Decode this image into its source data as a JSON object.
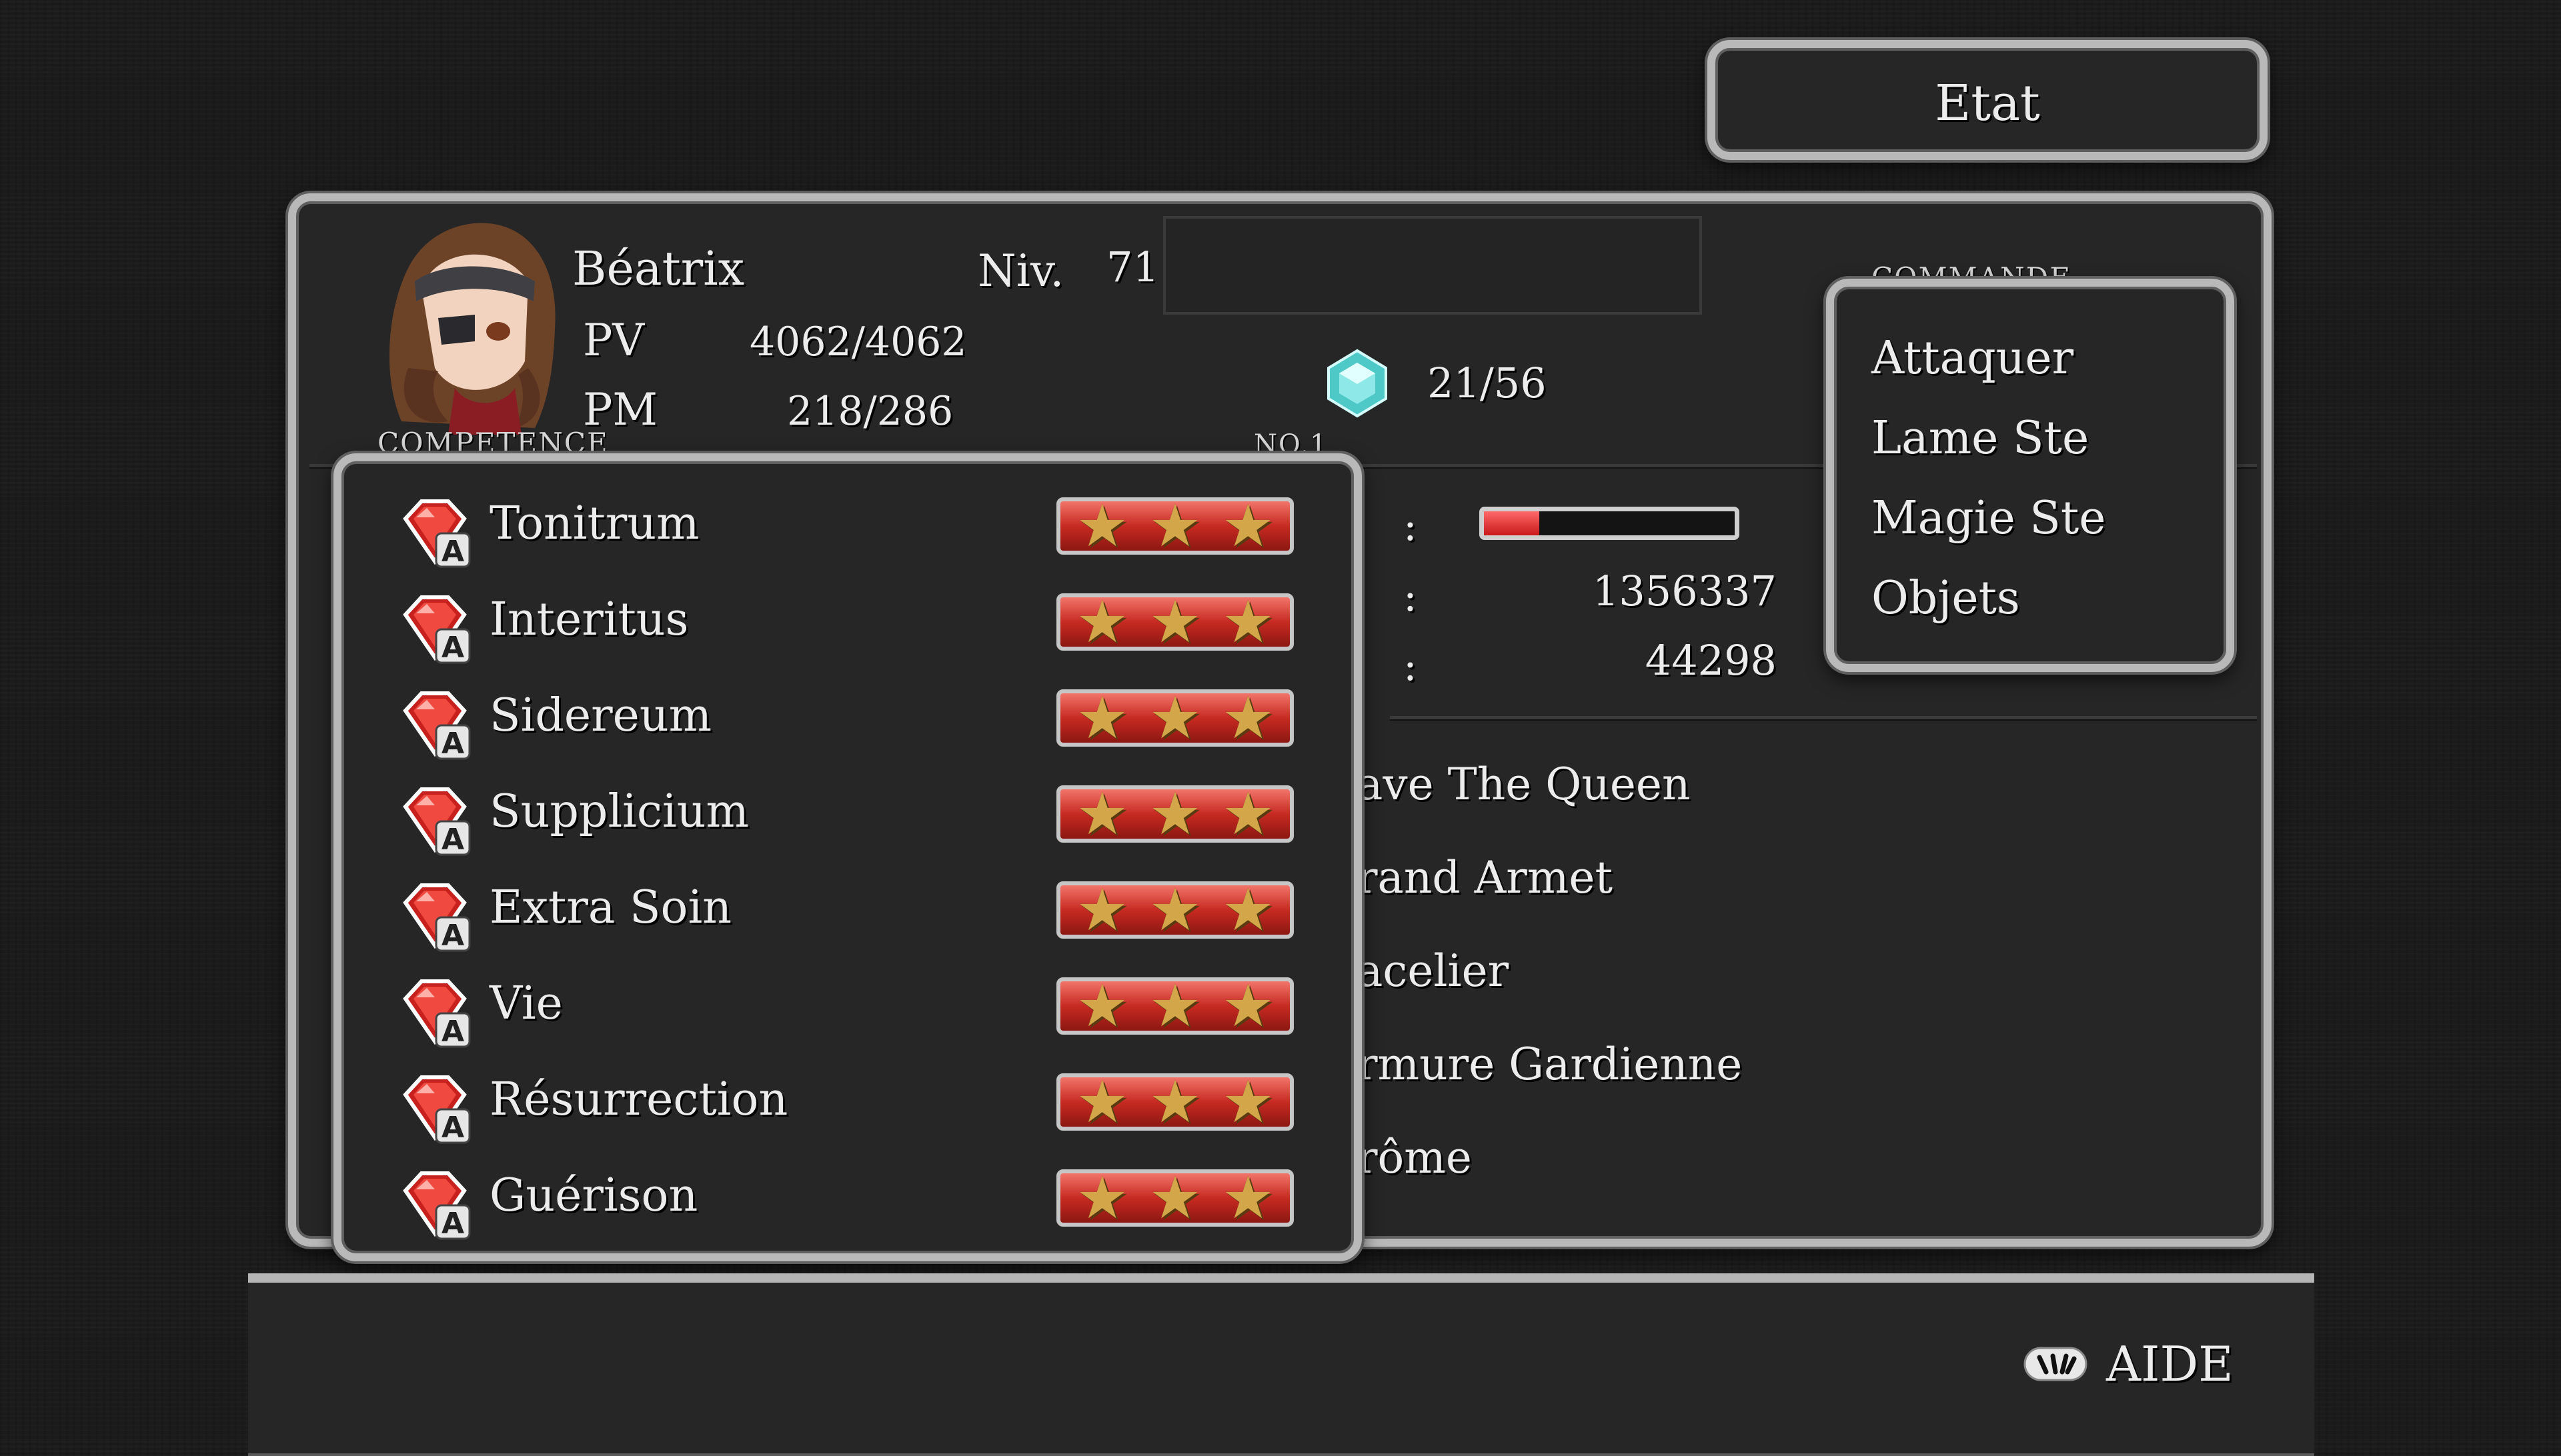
{
  "header": {
    "status_label": "Etat"
  },
  "character": {
    "name": "Béatrix",
    "level_label": "Niv.",
    "level": "71",
    "hp_label": "PV",
    "hp": "4062/4062",
    "mp_label": "PM",
    "mp": "218/286",
    "magic_stones": "21/56"
  },
  "stats": {
    "gauge_colon": ":",
    "gauge_fill": 0.22,
    "exp_colon": ":",
    "exp": "1356337",
    "next_colon": ":",
    "next": "44298"
  },
  "equipment": [
    "ave The Queen",
    "rand Armet",
    "acelier",
    "rmure Gardienne",
    "rôme"
  ],
  "commands": {
    "title": "COMMANDE",
    "items": [
      "Attaquer",
      "Lame Ste",
      "Magie Ste",
      "Objets"
    ]
  },
  "abilities": {
    "title": "COMPETENCE",
    "page": "NO.1",
    "items": [
      {
        "name": "Tonitrum",
        "stars": 3
      },
      {
        "name": "Interitus",
        "stars": 3
      },
      {
        "name": "Sidereum",
        "stars": 3
      },
      {
        "name": "Supplicium",
        "stars": 3
      },
      {
        "name": "Extra Soin",
        "stars": 3
      },
      {
        "name": "Vie",
        "stars": 3
      },
      {
        "name": "Résurrection",
        "stars": 3
      },
      {
        "name": "Guérison",
        "stars": 3
      }
    ]
  },
  "help": {
    "label": "AIDE"
  },
  "colors": {
    "gem_red": "#c8201c",
    "bar_red": "#d93a30",
    "star_gold": "#d4a64a",
    "frame": "#b9b9b9"
  }
}
